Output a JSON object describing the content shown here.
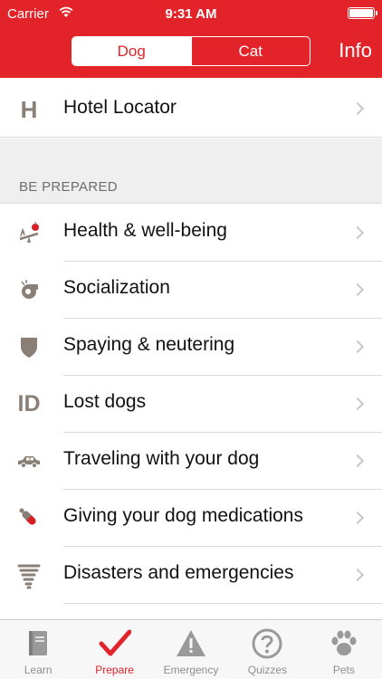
{
  "status_bar": {
    "carrier": "Carrier",
    "time": "9:31 AM"
  },
  "header": {
    "segments": [
      "Dog",
      "Cat"
    ],
    "selected_segment": "Dog",
    "info_label": "Info",
    "accent_color": "#e2232a"
  },
  "hotel": {
    "icon_text": "H",
    "label": "Hotel Locator"
  },
  "section": {
    "header": "BE PREPARED"
  },
  "items": [
    {
      "icon": "seesaw-apple-icon",
      "label": "Health & well-being"
    },
    {
      "icon": "whistle-icon",
      "label": "Socialization"
    },
    {
      "icon": "shield-icon",
      "label": "Spaying & neutering"
    },
    {
      "icon": "id-icon",
      "icon_text": "ID",
      "label": "Lost dogs"
    },
    {
      "icon": "car-icon",
      "label": "Traveling with your dog"
    },
    {
      "icon": "pill-icon",
      "label": "Giving your dog medications"
    },
    {
      "icon": "tornado-icon",
      "label": "Disasters and emergencies"
    }
  ],
  "tabbar": {
    "tabs": [
      {
        "icon": "book-icon",
        "label": "Learn"
      },
      {
        "icon": "checkmark-icon",
        "label": "Prepare"
      },
      {
        "icon": "warning-icon",
        "label": "Emergency"
      },
      {
        "icon": "question-icon",
        "label": "Quizzes"
      },
      {
        "icon": "paw-icon",
        "label": "Pets"
      }
    ],
    "selected": "Prepare"
  }
}
